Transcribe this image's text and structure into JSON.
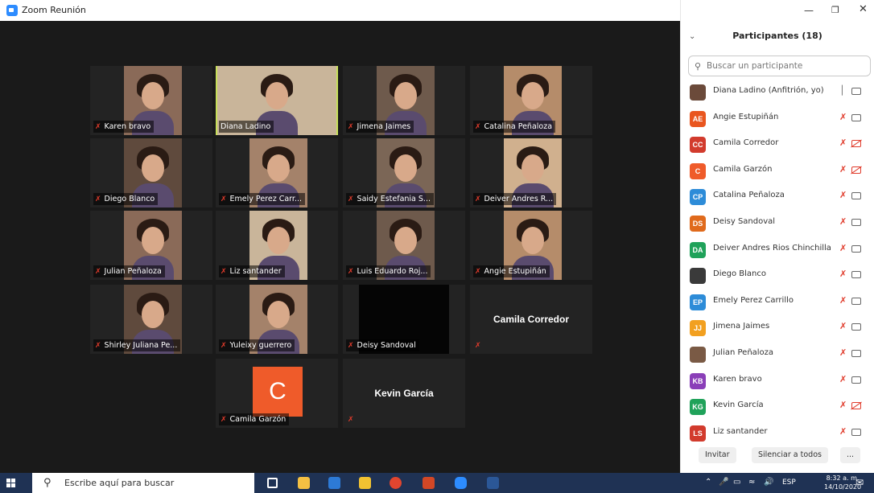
{
  "window": {
    "title": "Zoom Reunión"
  },
  "tiles": [
    {
      "caption": "Karen bravo",
      "row": 0,
      "col": 0,
      "muted": true
    },
    {
      "caption": "Diana Ladino",
      "row": 0,
      "col": 1,
      "muted": false,
      "active": true
    },
    {
      "caption": "Jimena Jaimes",
      "row": 0,
      "col": 2,
      "muted": true
    },
    {
      "caption": "Catalina Peñaloza",
      "row": 0,
      "col": 3,
      "muted": true
    },
    {
      "caption": "Diego Blanco",
      "row": 1,
      "col": 0,
      "muted": true
    },
    {
      "caption": "Emely Perez Carr...",
      "row": 1,
      "col": 1,
      "muted": true
    },
    {
      "caption": "Saidy Estefania S...",
      "row": 1,
      "col": 2,
      "muted": true
    },
    {
      "caption": "Deiver  Andres R...",
      "row": 1,
      "col": 3,
      "muted": true
    },
    {
      "caption": "Julian Peñaloza",
      "row": 2,
      "col": 0,
      "muted": true
    },
    {
      "caption": "Liz santander",
      "row": 2,
      "col": 1,
      "muted": true
    },
    {
      "caption": "Luis Eduardo Roj...",
      "row": 2,
      "col": 2,
      "muted": true
    },
    {
      "caption": "Angie Estupiñán",
      "row": 2,
      "col": 3,
      "muted": true
    },
    {
      "caption": "Shirley Juliana Pe...",
      "row": 3,
      "col": 0,
      "muted": true
    },
    {
      "caption": "Yuleixy guerrero",
      "row": 3,
      "col": 1,
      "muted": true
    },
    {
      "caption": "Deisy Sandoval",
      "row": 3,
      "col": 2,
      "muted": true,
      "blank": true
    },
    {
      "caption": "",
      "row": 3,
      "col": 3,
      "muted": true,
      "name_only": "Camila Corredor"
    },
    {
      "caption": "Camila Garzón",
      "row": 4,
      "col": 1,
      "muted": true,
      "avatar_letter": "C"
    },
    {
      "caption": "",
      "row": 4,
      "col": 2,
      "muted": true,
      "name_only": "Kevin García"
    }
  ],
  "panel": {
    "title": "Participantes (18)",
    "search_placeholder": "Buscar un participante",
    "participants": [
      {
        "initials": "",
        "photo": true,
        "name": "Diana Ladino (Anfitrión, yo)",
        "color": "#6b4a3a",
        "mic_on": true,
        "video_off": false
      },
      {
        "initials": "AE",
        "name": "Angie Estupiñán",
        "color": "#e9561f",
        "mic_on": false,
        "video_off": false
      },
      {
        "initials": "CC",
        "name": "Camila Corredor",
        "color": "#d23b2d",
        "mic_on": false,
        "video_off": true
      },
      {
        "initials": "C",
        "name": "Camila Garzón",
        "color": "#ef5b2a",
        "mic_on": false,
        "video_off": true
      },
      {
        "initials": "CP",
        "name": "Catalina Peñaloza",
        "color": "#2d8cd8",
        "mic_on": false,
        "video_off": false
      },
      {
        "initials": "DS",
        "name": "Deisy Sandoval",
        "color": "#e06a1c",
        "mic_on": false,
        "video_off": false
      },
      {
        "initials": "DA",
        "name": "Deiver  Andres Rios Chinchilla",
        "color": "#20a25a",
        "mic_on": false,
        "video_off": false
      },
      {
        "initials": "",
        "photo": true,
        "name": "Diego Blanco",
        "color": "#3a3a3a",
        "mic_on": false,
        "video_off": false
      },
      {
        "initials": "EP",
        "name": "Emely Perez Carrillo",
        "color": "#2d8cd8",
        "mic_on": false,
        "video_off": false
      },
      {
        "initials": "JJ",
        "name": "Jimena Jaimes",
        "color": "#f2a020",
        "mic_on": false,
        "video_off": false
      },
      {
        "initials": "",
        "photo": true,
        "name": "Julian Peñaloza",
        "color": "#7a5a45",
        "mic_on": false,
        "video_off": false
      },
      {
        "initials": "KB",
        "name": "Karen bravo",
        "color": "#8a3fb8",
        "mic_on": false,
        "video_off": false
      },
      {
        "initials": "KG",
        "name": "Kevin García",
        "color": "#20a25a",
        "mic_on": false,
        "video_off": true
      },
      {
        "initials": "LS",
        "name": "Liz santander",
        "color": "#d23b2d",
        "mic_on": false,
        "video_off": false
      }
    ],
    "buttons": {
      "invite": "Invitar",
      "mute_all": "Silenciar a todos",
      "more": "..."
    }
  },
  "taskbar": {
    "search_placeholder": "Escribe aquí para buscar",
    "language": "ESP",
    "time": "8:32 a. m.",
    "date": "14/10/2020"
  }
}
